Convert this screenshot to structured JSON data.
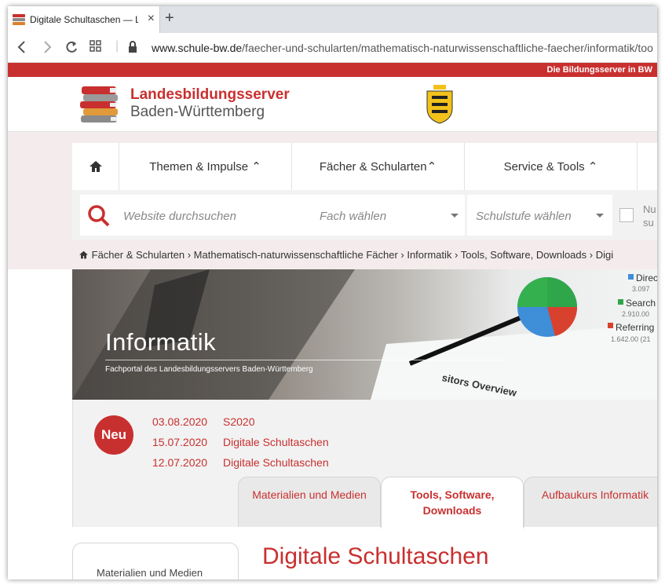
{
  "browser": {
    "tab_title": "Digitale Schultaschen — La",
    "new_tab": "+",
    "close": "×",
    "url_host": "www.schule-bw.de",
    "url_path": "/faecher-und-schularten/mathematisch-naturwissenschaftliche-faecher/informatik/too"
  },
  "topbar": {
    "text": "Die Bildungsserver in BW"
  },
  "header": {
    "title": "Landesbildungsserver",
    "subtitle": "Baden-Württemberg"
  },
  "nav": {
    "items": [
      {
        "label": "Themen & Impulse ⌃"
      },
      {
        "label": "Fächer & Schularten⌃"
      },
      {
        "label": "Service & Tools    ⌃"
      }
    ]
  },
  "search": {
    "placeholder": "Website durchsuchen",
    "subject": "Fach wählen",
    "level": "Schulstufe wählen",
    "checkbox_label_1": "Nu",
    "checkbox_label_2": "su"
  },
  "breadcrumb": "Fächer & Schularten › Mathematisch-naturwissenschaftliche Fächer › Informatik › Tools, Software, Downloads › Digi",
  "hero": {
    "title": "Informatik",
    "subtitle": "Fachportal des Landesbildungsservers Baden-Württemberg",
    "screen_caption": "sitors Overview",
    "legend": [
      "Direc",
      "3.097",
      "Search",
      "2.910.00",
      "Referring",
      "1.642.00 (21"
    ]
  },
  "news": {
    "badge": "Neu",
    "items": [
      {
        "date": "03.08.2020",
        "title": "S2020"
      },
      {
        "date": "15.07.2020",
        "title": "Digitale Schultaschen"
      },
      {
        "date": "12.07.2020",
        "title": "Digitale Schultaschen"
      }
    ]
  },
  "content_tabs": [
    {
      "label": "Materialien und Medien"
    },
    {
      "label": "Tools, Software, Downloads"
    },
    {
      "label": "Aufbaukurs Informatik"
    }
  ],
  "sidebar": {
    "label": "Materialien und Medien"
  },
  "page": {
    "heading": "Digitale Schultaschen"
  },
  "colors": {
    "brand_red": "#c8302f"
  },
  "icons": [
    "book-stack-icon",
    "coat-of-arms-icon",
    "home-icon",
    "search-icon",
    "lock-icon",
    "back-icon",
    "forward-icon",
    "reload-icon",
    "apps-icon"
  ]
}
